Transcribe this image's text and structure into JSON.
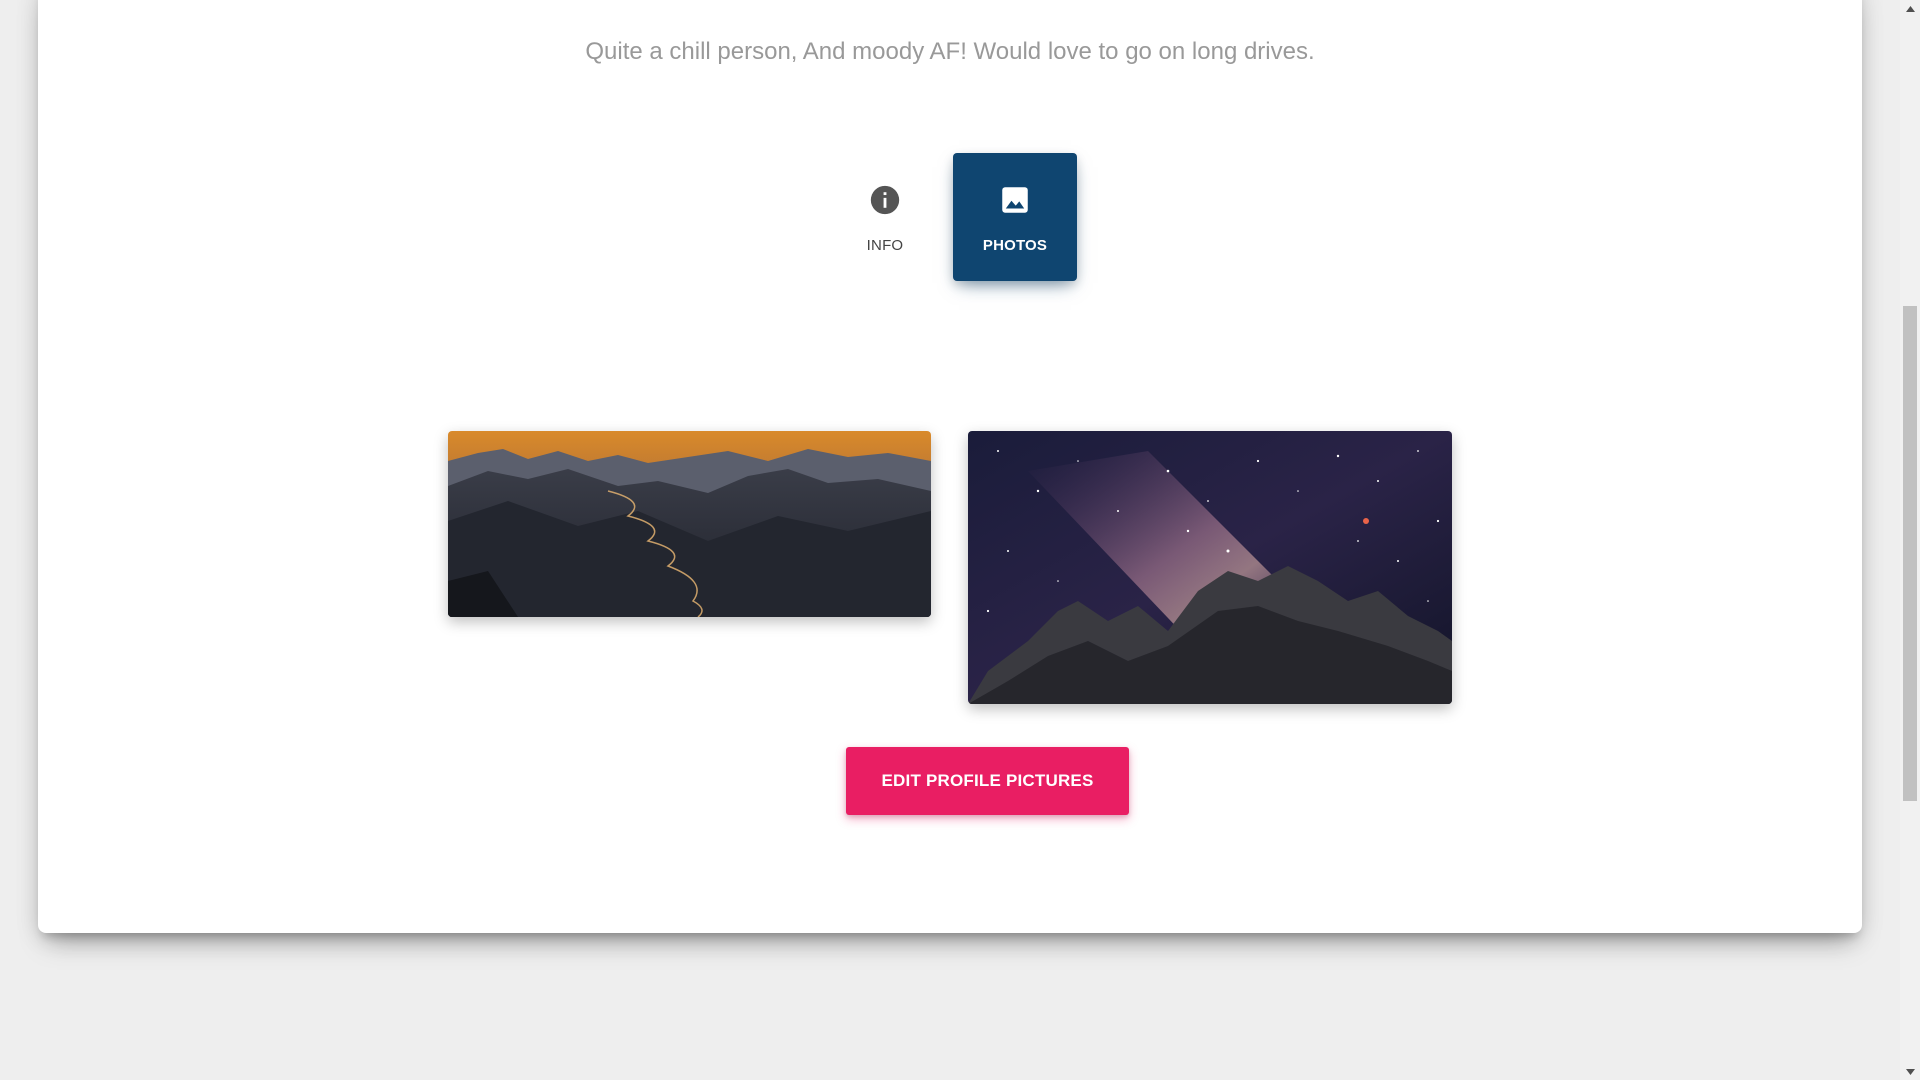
{
  "profile": {
    "bio": "Quite a chill person, And moody AF! Would love to go on long drives."
  },
  "tabs": [
    {
      "label": "INFO",
      "icon": "info-icon",
      "active": false
    },
    {
      "label": "PHOTOS",
      "icon": "image-icon",
      "active": true
    }
  ],
  "gallery": {
    "photos": [
      {
        "subject": "mountain-sunset-road-photo"
      },
      {
        "subject": "milky-way-mountains-photo"
      }
    ]
  },
  "actions": {
    "edit_pictures_label": "EDIT PROFILE PICTURES"
  },
  "colors": {
    "active_tab": "#0f4570",
    "accent_button": "#e91e63",
    "page_background": "#eeeeee",
    "bio_text": "#999999"
  }
}
